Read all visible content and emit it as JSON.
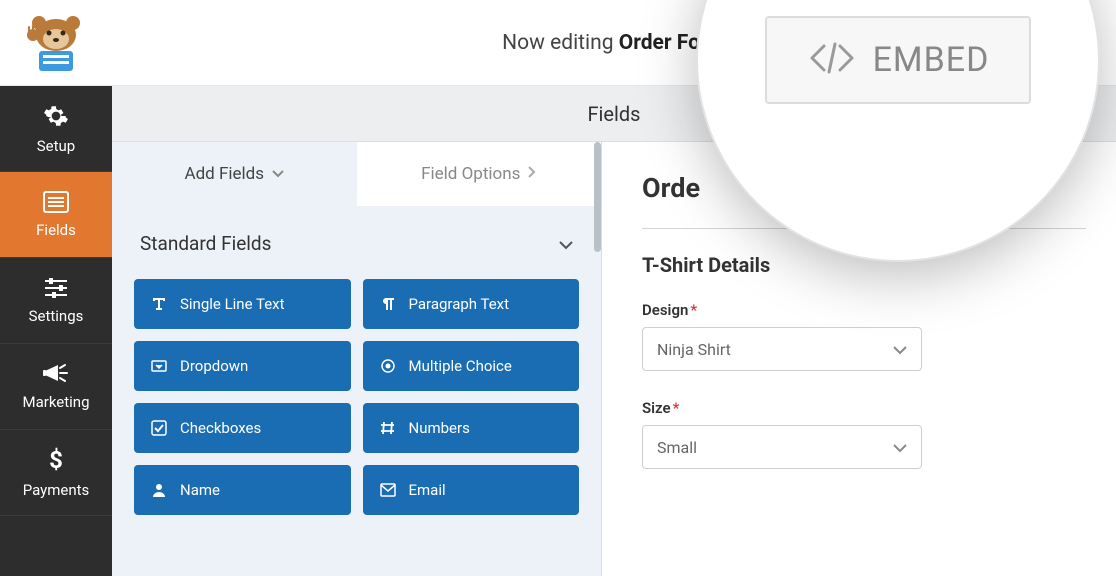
{
  "header": {
    "editing_prefix": "Now editing ",
    "form_name": "Order Form",
    "subheader": "Fields"
  },
  "sidebar": {
    "items": [
      {
        "key": "setup",
        "label": "Setup"
      },
      {
        "key": "fields",
        "label": "Fields"
      },
      {
        "key": "settings",
        "label": "Settings"
      },
      {
        "key": "marketing",
        "label": "Marketing"
      },
      {
        "key": "payments",
        "label": "Payments"
      }
    ],
    "active": "fields"
  },
  "left_panel": {
    "tabs": {
      "add": "Add Fields",
      "options": "Field Options"
    },
    "section": "Standard Fields",
    "fields": [
      {
        "label": "Single Line Text"
      },
      {
        "label": "Paragraph Text"
      },
      {
        "label": "Dropdown"
      },
      {
        "label": "Multiple Choice"
      },
      {
        "label": "Checkboxes"
      },
      {
        "label": "Numbers"
      },
      {
        "label": "Name"
      },
      {
        "label": "Email"
      }
    ]
  },
  "preview": {
    "form_title_partial": "Orde",
    "section": "T-Shirt Details",
    "fields": {
      "design": {
        "label": "Design",
        "required_mark": "*",
        "value": "Ninja Shirt"
      },
      "size": {
        "label": "Size",
        "required_mark": "*",
        "value": "Small"
      }
    }
  },
  "callout": {
    "embed_label": "EMBED"
  }
}
